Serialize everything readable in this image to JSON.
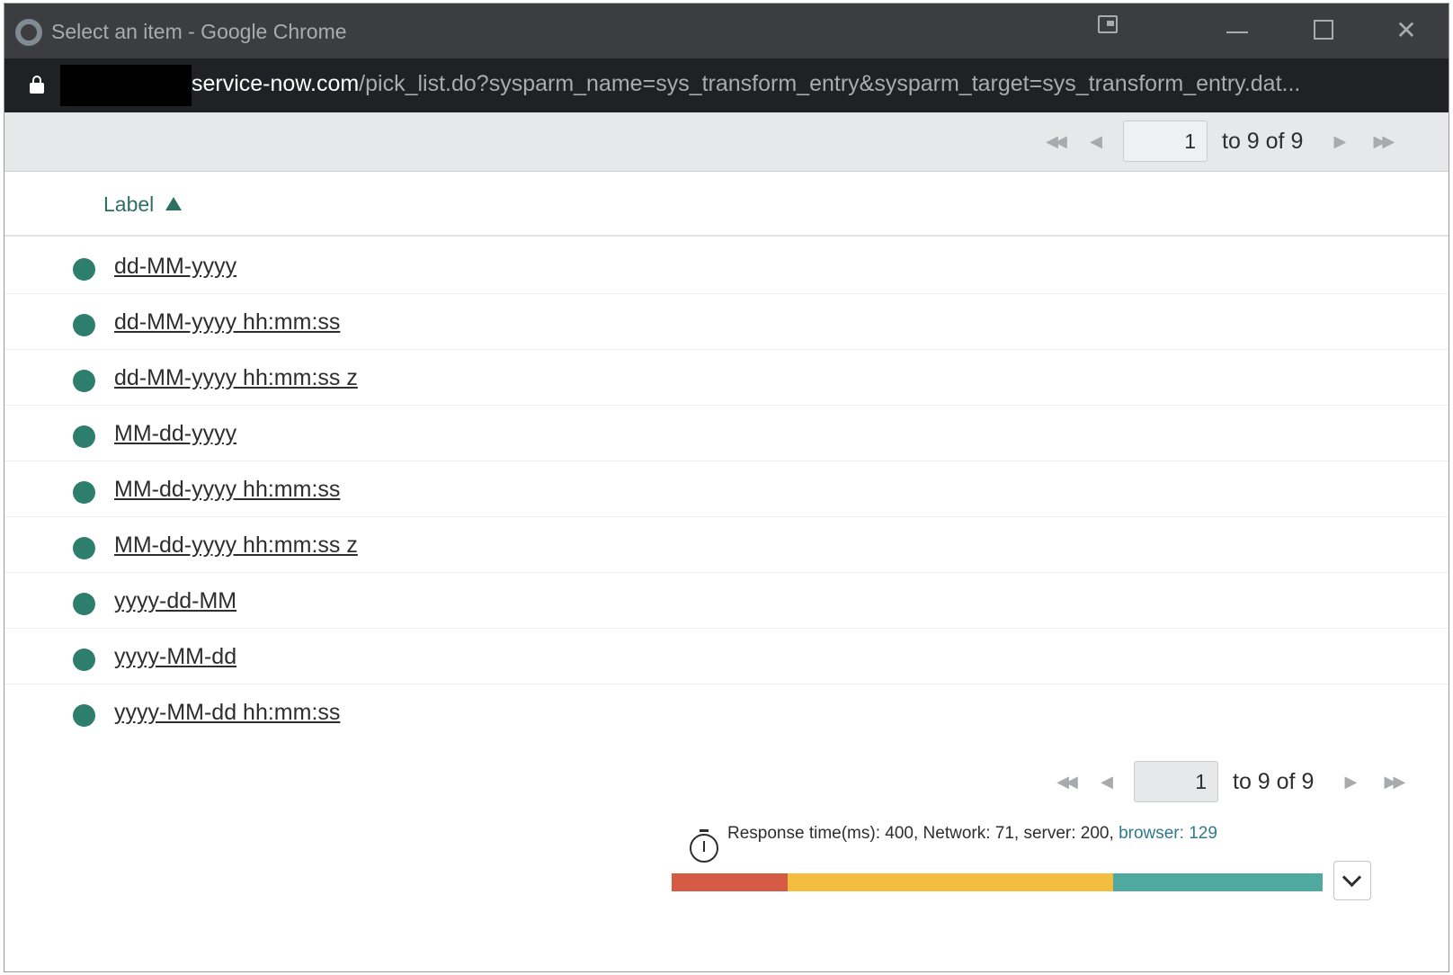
{
  "window": {
    "title": "Select an item - Google Chrome"
  },
  "address_bar": {
    "host": "service-now.com",
    "path": "/pick_list.do?sysparm_name=sys_transform_entry&sysparm_target=sys_transform_entry.dat..."
  },
  "pagination": {
    "first_icon": "double-left-arrow",
    "prev_icon": "left-arrow",
    "page_value": "1",
    "range_text": "to 9 of 9",
    "next_icon": "right-arrow",
    "last_icon": "double-right-arrow"
  },
  "list": {
    "column_label": "Label",
    "sort": "ascending",
    "rows": [
      "dd-MM-yyyy",
      "dd-MM-yyyy hh:mm:ss",
      "dd-MM-yyyy hh:mm:ss z",
      "MM-dd-yyyy",
      "MM-dd-yyyy hh:mm:ss",
      "MM-dd-yyyy hh:mm:ss z",
      "yyyy-dd-MM",
      "yyyy-MM-dd",
      "yyyy-MM-dd hh:mm:ss"
    ]
  },
  "response": {
    "text": "Response time(ms): 400, Network: 71, server: 200, ",
    "browser_text": "browser: 129",
    "segments": [
      {
        "name": "network",
        "value": 71,
        "color": "#d65b45"
      },
      {
        "name": "server",
        "value": 200,
        "color": "#f3bd40"
      },
      {
        "name": "browser",
        "value": 129,
        "color": "#4fa9a0"
      }
    ]
  },
  "colors": {
    "accent": "#2f6e62",
    "dot": "#2e7e6e",
    "titlebar": "#3c3d40",
    "addressbar": "#202124"
  }
}
